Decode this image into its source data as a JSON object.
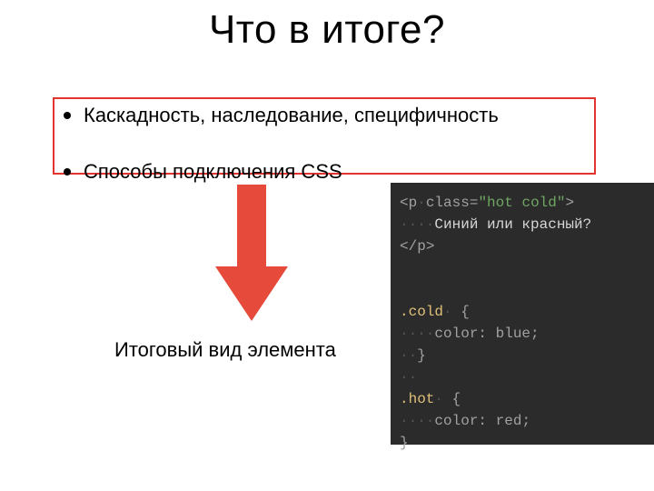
{
  "slide": {
    "title": "Что в итоге?",
    "bullets": [
      "Каскадность, наследование, специфичность",
      "Способы подключения CSS"
    ],
    "arrow_color": "#e64a3b",
    "caption": "Итоговый вид элемента",
    "code": {
      "tag_open_lt": "<",
      "tag_name": "p",
      "attr_name": "class",
      "attr_eq": "=",
      "attr_value_quoted": "\"hot cold\"",
      "tag_open_gt": ">",
      "inner_text": "Синий или красный?",
      "tag_close": "</",
      "tag_close_gt": ">",
      "sel_cold": ".cold",
      "sel_hot": ".hot",
      "brace_open": " {",
      "brace_close": "}",
      "prop_color": "color",
      "colon": ": ",
      "val_blue": "blue",
      "val_red": "red",
      "semi": ";",
      "ws4": "····",
      "ws2": "··",
      "ws1": "·"
    }
  }
}
